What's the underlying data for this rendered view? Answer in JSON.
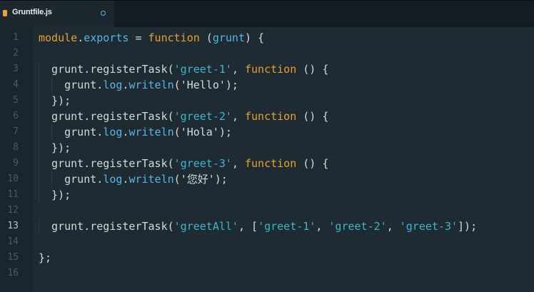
{
  "tab": {
    "filename": "Gruntfile.js",
    "modified": true
  },
  "editor": {
    "active_line": 13,
    "line_numbers": [
      "1",
      "2",
      "3",
      "4",
      "5",
      "6",
      "7",
      "8",
      "9",
      "10",
      "11",
      "12",
      "13",
      "14",
      "15",
      "16"
    ],
    "lines": [
      [
        {
          "t": "module",
          "c": "kw"
        },
        {
          "t": ".",
          "c": "punc"
        },
        {
          "t": "exports",
          "c": "prop"
        },
        {
          "t": " = ",
          "c": "punc"
        },
        {
          "t": "function",
          "c": "kw"
        },
        {
          "t": " (",
          "c": "punc"
        },
        {
          "t": "grunt",
          "c": "prop"
        },
        {
          "t": ") {",
          "c": "punc"
        }
      ],
      [],
      [
        {
          "t": "  grunt",
          "c": "fn"
        },
        {
          "t": ".",
          "c": "punc"
        },
        {
          "t": "registerTask",
          "c": "fn"
        },
        {
          "t": "(",
          "c": "punc"
        },
        {
          "t": "'greet-1'",
          "c": "str"
        },
        {
          "t": ", ",
          "c": "punc"
        },
        {
          "t": "function",
          "c": "kw"
        },
        {
          "t": " () {",
          "c": "punc"
        }
      ],
      [
        {
          "t": "    grunt",
          "c": "fn"
        },
        {
          "t": ".",
          "c": "punc"
        },
        {
          "t": "log",
          "c": "prop"
        },
        {
          "t": ".",
          "c": "punc"
        },
        {
          "t": "writeln",
          "c": "prop"
        },
        {
          "t": "(",
          "c": "punc"
        },
        {
          "t": "'Hello'",
          "c": "fn"
        },
        {
          "t": ");",
          "c": "punc"
        }
      ],
      [
        {
          "t": "  });",
          "c": "punc"
        }
      ],
      [
        {
          "t": "  grunt",
          "c": "fn"
        },
        {
          "t": ".",
          "c": "punc"
        },
        {
          "t": "registerTask",
          "c": "fn"
        },
        {
          "t": "(",
          "c": "punc"
        },
        {
          "t": "'greet-2'",
          "c": "str"
        },
        {
          "t": ", ",
          "c": "punc"
        },
        {
          "t": "function",
          "c": "kw"
        },
        {
          "t": " () {",
          "c": "punc"
        }
      ],
      [
        {
          "t": "    grunt",
          "c": "fn"
        },
        {
          "t": ".",
          "c": "punc"
        },
        {
          "t": "log",
          "c": "prop"
        },
        {
          "t": ".",
          "c": "punc"
        },
        {
          "t": "writeln",
          "c": "prop"
        },
        {
          "t": "(",
          "c": "punc"
        },
        {
          "t": "'Hola'",
          "c": "fn"
        },
        {
          "t": ");",
          "c": "punc"
        }
      ],
      [
        {
          "t": "  });",
          "c": "punc"
        }
      ],
      [
        {
          "t": "  grunt",
          "c": "fn"
        },
        {
          "t": ".",
          "c": "punc"
        },
        {
          "t": "registerTask",
          "c": "fn"
        },
        {
          "t": "(",
          "c": "punc"
        },
        {
          "t": "'greet-3'",
          "c": "str"
        },
        {
          "t": ", ",
          "c": "punc"
        },
        {
          "t": "function",
          "c": "kw"
        },
        {
          "t": " () {",
          "c": "punc"
        }
      ],
      [
        {
          "t": "    grunt",
          "c": "fn"
        },
        {
          "t": ".",
          "c": "punc"
        },
        {
          "t": "log",
          "c": "prop"
        },
        {
          "t": ".",
          "c": "punc"
        },
        {
          "t": "writeln",
          "c": "prop"
        },
        {
          "t": "(",
          "c": "punc"
        },
        {
          "t": "'您好'",
          "c": "fn"
        },
        {
          "t": ");",
          "c": "punc"
        }
      ],
      [
        {
          "t": "  });",
          "c": "punc"
        }
      ],
      [],
      [
        {
          "t": "  grunt",
          "c": "fn"
        },
        {
          "t": ".",
          "c": "punc"
        },
        {
          "t": "registerTask",
          "c": "fn"
        },
        {
          "t": "(",
          "c": "punc"
        },
        {
          "t": "'greetAll'",
          "c": "str"
        },
        {
          "t": ", [",
          "c": "punc"
        },
        {
          "t": "'greet-1'",
          "c": "str"
        },
        {
          "t": ", ",
          "c": "punc"
        },
        {
          "t": "'greet-2'",
          "c": "str"
        },
        {
          "t": ", ",
          "c": "punc"
        },
        {
          "t": "'greet-3'",
          "c": "str"
        },
        {
          "t": "]);",
          "c": "punc"
        }
      ],
      [],
      [
        {
          "t": "};",
          "c": "punc"
        }
      ],
      []
    ]
  },
  "colors": {
    "background": "#1e2b33",
    "keyword": "#e8a12c",
    "property": "#58b5e3",
    "string": "#3fb5cc",
    "text": "#d4dadc"
  }
}
